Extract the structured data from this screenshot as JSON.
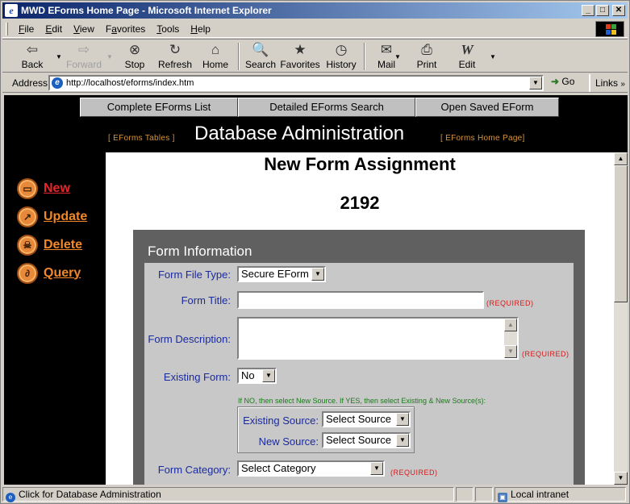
{
  "window": {
    "title": "MWD EForms Home Page - Microsoft Internet Explorer",
    "buttons": {
      "minimize": "_",
      "maximize": "□",
      "close": "✕"
    }
  },
  "menu": [
    {
      "pre": "",
      "u": "F",
      "post": "ile"
    },
    {
      "pre": "",
      "u": "E",
      "post": "dit"
    },
    {
      "pre": "",
      "u": "V",
      "post": "iew"
    },
    {
      "pre": "F",
      "u": "a",
      "post": "vorites"
    },
    {
      "pre": "",
      "u": "T",
      "post": "ools"
    },
    {
      "pre": "",
      "u": "H",
      "post": "elp"
    }
  ],
  "toolbar": {
    "back": "Back",
    "forward": "Forward",
    "stop": "Stop",
    "refresh": "Refresh",
    "home": "Home",
    "search": "Search",
    "favorites": "Favorites",
    "history": "History",
    "mail": "Mail",
    "print": "Print",
    "edit": "Edit"
  },
  "address": {
    "label": "Address",
    "url": "http://localhost/eforms/index.htm",
    "go": "Go",
    "links": "Links"
  },
  "page": {
    "nav": [
      "Complete EForms List",
      "Detailed EForms Search",
      "Open Saved EForm"
    ],
    "db_title": "Database Administration",
    "link_tables": "[ EForms Tables ]",
    "link_home": "[ EForms Home Page]",
    "side": {
      "new": "New",
      "update": "Update",
      "delete": "Delete",
      "query": "Query"
    },
    "heading": "New Form Assignment",
    "number": "2192",
    "form": {
      "section": "Form Information",
      "file_type_label": "Form File Type:",
      "file_type_value": "Secure EForm",
      "title_label": "Form Title:",
      "title_value": "",
      "desc_label": "Form Description:",
      "existing_label": "Existing Form:",
      "existing_value": "No",
      "hint": "If NO, then select New Source. If YES, then select Existing & New Source(s):",
      "existing_source_label": "Existing Source:",
      "existing_source_value": "Select Source",
      "new_source_label": "New Source:",
      "new_source_value": "Select Source",
      "category_label": "Form Category:",
      "category_value": "Select Category",
      "required": "(REQUIRED)"
    }
  },
  "status": {
    "text": "Click for Database Administration",
    "zone": "Local intranet"
  }
}
